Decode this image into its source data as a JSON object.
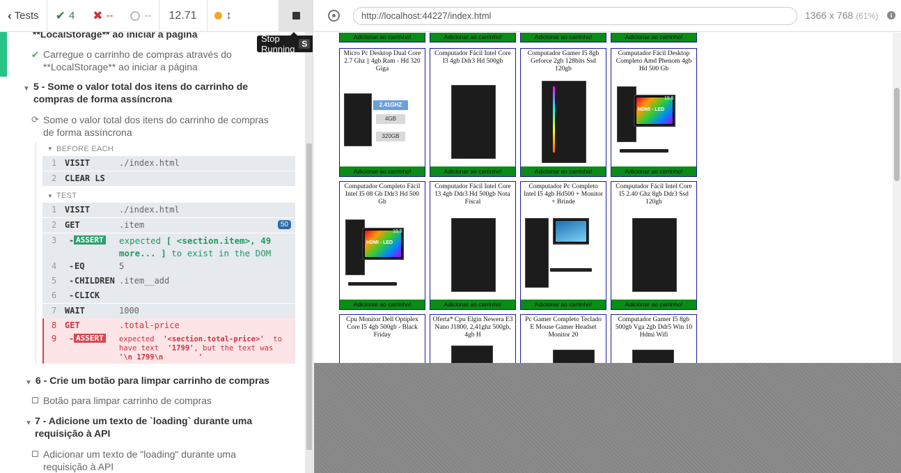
{
  "stats": {
    "tests_label": "Tests",
    "passed": "4",
    "failed": "--",
    "pending": "--",
    "duration": "12.71"
  },
  "tooltip": {
    "label": "Stop Running",
    "key": "S"
  },
  "reporter": {
    "prev_test_tail": "**LocalStorage** ao iniciar a página",
    "test_load_cart": "Carregue o carrinho de compras através do **LocalStorage** ao iniciar a página",
    "suite5": "5 - Some o valor total dos itens do carrinho de compras de forma assíncrona",
    "test5": "Some o valor total dos itens do carrinho de compras de forma assíncrona",
    "before_each": "BEFORE EACH",
    "test_hdr": "TEST",
    "before_cmds": [
      {
        "num": "1",
        "name": "VISIT",
        "msg": "./index.html"
      },
      {
        "num": "2",
        "name": "CLEAR LS",
        "msg": ""
      }
    ],
    "test_cmds": [
      {
        "num": "1",
        "name": "VISIT",
        "msg": "./index.html"
      },
      {
        "num": "2",
        "name": "GET",
        "msg": ".item",
        "badge": "50"
      },
      {
        "num": "3",
        "name": "ASSERT",
        "msg_a": "expected",
        "msg_b": "[ <section.item>, 49 more... ]",
        "msg_c": "to exist in the DOM"
      },
      {
        "num": "4",
        "name": "EQ",
        "msg": "5"
      },
      {
        "num": "5",
        "name": "CHILDREN",
        "msg": ".item__add"
      },
      {
        "num": "6",
        "name": "CLICK",
        "msg": ""
      },
      {
        "num": "7",
        "name": "WAIT",
        "msg": "1000"
      },
      {
        "num": "8",
        "name": "GET",
        "msg": ".total-price"
      },
      {
        "num": "9",
        "name": "ASSERT",
        "msg_a": "expected",
        "msg_b": "'<section.total-price>'",
        "msg_c": "to have text",
        "msg_d": "'1799'",
        "msg_e": ", but the text was",
        "msg_f": "'\\n 1799\\n        '"
      }
    ],
    "suite6": "6 - Crie um botão para limpar carrinho de compras",
    "test6": "Botão para limpar carrinho de compras",
    "suite7": "7 - Adicione um texto de `loading` durante uma requisição à API",
    "test7": "Adicionar um texto de \"loading\" durante uma requisição à API"
  },
  "aut_header": {
    "url": "http://localhost:44227/index.html",
    "viewport": "1366 x 768",
    "scale": "(61%)"
  },
  "products": {
    "add_label": "Adicionar ao carrinho!",
    "items": [
      "Micro Pc Desktop Dual Core 2.7 Ghz || 4gb Ram - Hd 320 Giga",
      "Computador Fácil Intel Core I3 4gb Ddr3 Hd 500gb",
      "Computador Gamer I5 8gb Geforce 2gb 128bits Ssd 120gb",
      "Computador Fácil Desktop Completo Amd Phenom 4gb Hd 500 Gb",
      "Computador Completo Fácil Intel I5 08 Gb Ddr3 Hd 500 Gb",
      "Computador Fácil Intel Core I3 4gb Ddr3 Hd 500gb Nota Fiscal",
      "Computador Pc Completo Intel I5 4gb Hd500 + Monitor + Brinde",
      "Computador Fácil Intel Core I5 2.40 Ghz 8gb Ddr3 Ssd 120gb",
      "Cpu Monitor Dell Optiplex Core I5 4gb 500gb - Black Friday",
      "Oferta* Cpu Elgin Newera E3 Nano J1800, 2,41ghz 500gb, 4gb H",
      "Pc Gamer Completo Teclado E Mouse Gamer Headset Monitor 20",
      "Computador Gamer I5 8gb 500gb Vga 2gb Ddr5 Win 10 Hdmi Wifi"
    ],
    "img_labels": {
      "ghz": "2.41GHZ",
      "ram": "4GB",
      "hd": "320GB",
      "hdmi": "HDMI - LED",
      "size": "19,5"
    }
  }
}
